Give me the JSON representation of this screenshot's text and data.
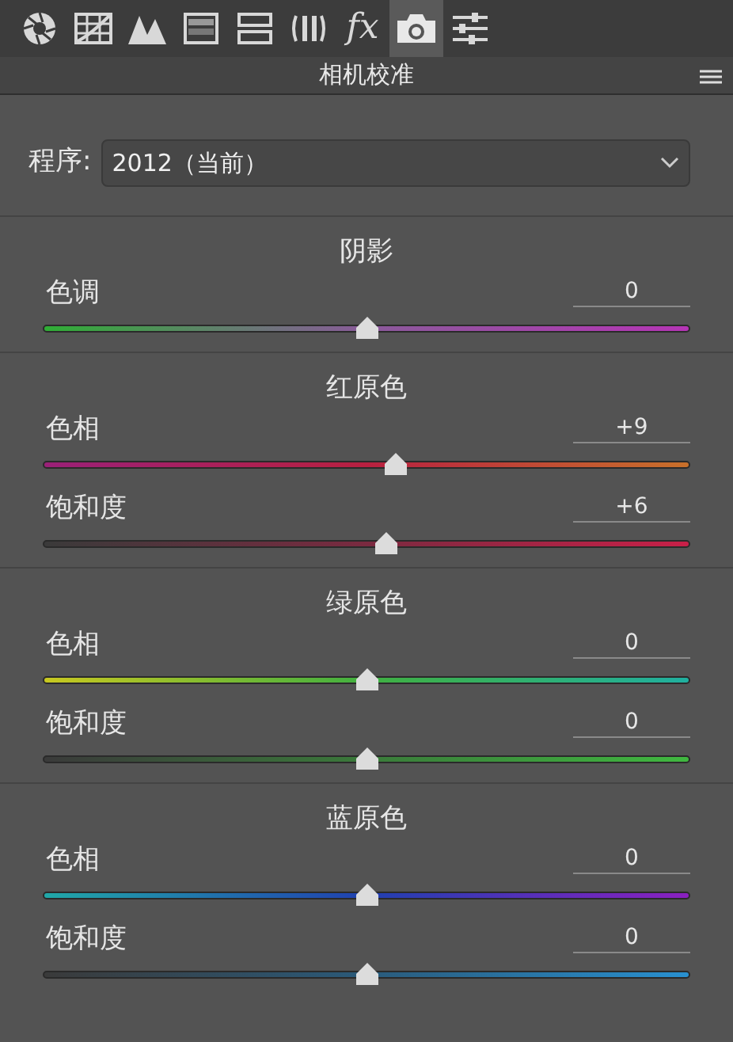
{
  "toolbar": {
    "tabs": [
      {
        "kind": "aperture",
        "selected": false
      },
      {
        "kind": "curve",
        "selected": false
      },
      {
        "kind": "mountains",
        "selected": false
      },
      {
        "kind": "hsl",
        "selected": false
      },
      {
        "kind": "split",
        "selected": false
      },
      {
        "kind": "lens",
        "selected": false
      },
      {
        "kind": "fx",
        "label": "fx",
        "selected": false
      },
      {
        "kind": "camera",
        "selected": true
      },
      {
        "kind": "sliders",
        "selected": false
      }
    ]
  },
  "panel": {
    "title": "相机校准"
  },
  "process": {
    "label": "程序:",
    "value": "2012（当前）"
  },
  "sections": [
    {
      "title": "阴影",
      "sliders": [
        {
          "label": "色调",
          "value": "0",
          "level": 0.5,
          "kind": "tint"
        }
      ]
    },
    {
      "title": "红原色",
      "sliders": [
        {
          "label": "色相",
          "value": "+9",
          "level": 0.545,
          "kind": "redhue"
        },
        {
          "label": "饱和度",
          "value": "+6",
          "level": 0.53,
          "kind": "redsat"
        }
      ]
    },
    {
      "title": "绿原色",
      "sliders": [
        {
          "label": "色相",
          "value": "0",
          "level": 0.5,
          "kind": "greenhue"
        },
        {
          "label": "饱和度",
          "value": "0",
          "level": 0.5,
          "kind": "greensat"
        }
      ]
    },
    {
      "title": "蓝原色",
      "sliders": [
        {
          "label": "色相",
          "value": "0",
          "level": 0.5,
          "kind": "bluehue"
        },
        {
          "label": "饱和度",
          "value": "0",
          "level": 0.5,
          "kind": "bluesat"
        }
      ]
    }
  ]
}
